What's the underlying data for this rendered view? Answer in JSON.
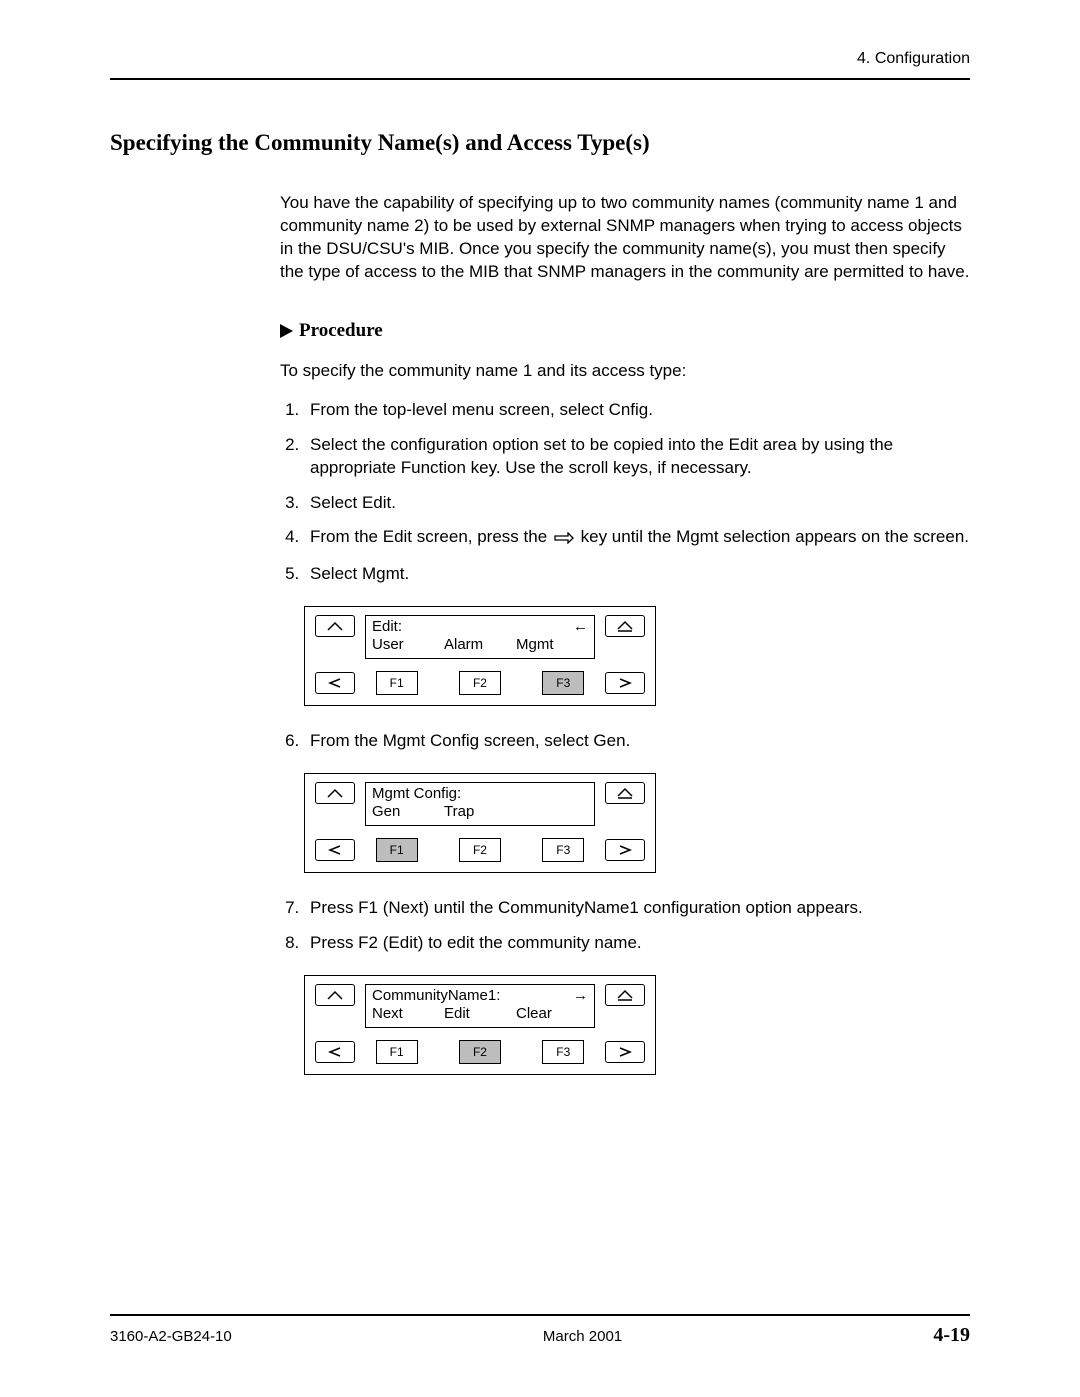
{
  "header": {
    "chapter": "4. Configuration"
  },
  "title": "Specifying the Community Name(s) and Access Type(s)",
  "intro": "You have the capability of specifying up to two community names (community name 1 and community name 2) to be used by external SNMP managers when trying to access objects in the DSU/CSU's MIB. Once you specify the community name(s), you must then specify the type of access to the MIB that SNMP managers in the community are permitted to have.",
  "procedure_label": "Procedure",
  "procedure_lead": "To specify the community name 1 and its access type:",
  "steps": {
    "s1": "From the top-level menu screen, select Cnfig.",
    "s2": "Select the configuration option set to be copied into the Edit area by using the appropriate Function key. Use the scroll keys, if necessary.",
    "s3": "Select Edit.",
    "s4a": "From the Edit screen, press the ",
    "s4b": " key until the Mgmt selection appears on the screen.",
    "s5": "Select Mgmt.",
    "s6": "From the Mgmt Config screen, select Gen.",
    "s7": "Press F1 (Next) until the CommunityName1 configuration option appears.",
    "s8": "Press F2 (Edit) to edit the community name."
  },
  "fkeys": {
    "f1": "F1",
    "f2": "F2",
    "f3": "F3"
  },
  "panel1": {
    "title": "Edit:",
    "opts": {
      "o1": "User",
      "o2": "Alarm",
      "o3": "Mgmt"
    },
    "selected": "F3",
    "arrow": "left"
  },
  "panel2": {
    "title": "Mgmt Config:",
    "opts": {
      "o1": "Gen",
      "o2": "Trap",
      "o3": ""
    },
    "selected": "F1",
    "arrow": ""
  },
  "panel3": {
    "title": "CommunityName1:",
    "opts": {
      "o1": "Next",
      "o2": "Edit",
      "o3": "Clear"
    },
    "selected": "F2",
    "arrow": "right"
  },
  "footer": {
    "doc": "3160-A2-GB24-10",
    "date": "March 2001",
    "page": "4-19"
  }
}
